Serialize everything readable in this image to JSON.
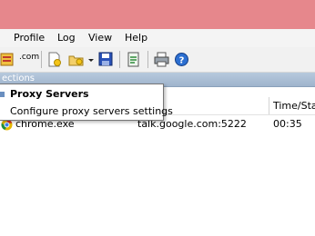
{
  "menu": [
    "Profile",
    "Log",
    "View",
    "Help"
  ],
  "toolbar": {
    "icons": [
      "rules-icon",
      "dns-icon",
      "new-profile-icon",
      "open-profile-icon",
      "save-profile-icon",
      "export-icon",
      "print-icon",
      "help-icon"
    ],
    "dns_label": ".com"
  },
  "section": {
    "title": "ections"
  },
  "table": {
    "headers": [
      "Time/Stat"
    ],
    "rows": [
      {
        "app": "chrome.exe",
        "target": "talk.google.com:5222",
        "time": "00:35"
      }
    ]
  },
  "tooltip": {
    "title": "Proxy Servers",
    "description": "Configure proxy servers settings"
  },
  "colors": {
    "titlebar": "#e6878c",
    "section_bar": "#a9bdd4"
  }
}
